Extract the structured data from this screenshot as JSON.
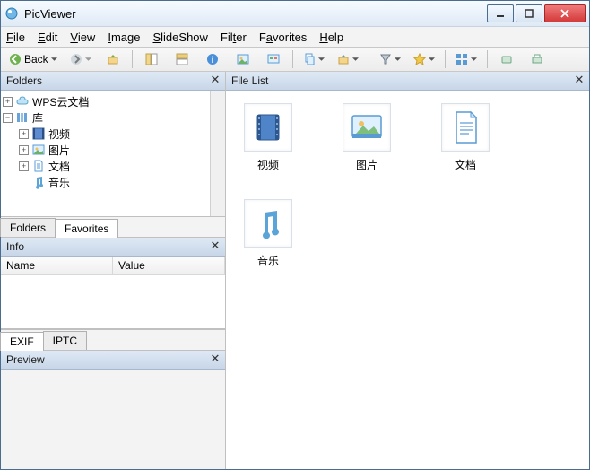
{
  "app": {
    "title": "PicViewer"
  },
  "menu": [
    "File",
    "Edit",
    "View",
    "Image",
    "SlideShow",
    "Filter",
    "Favorites",
    "Help"
  ],
  "toolbar": {
    "back": "Back"
  },
  "left": {
    "folders_panel_title": "Folders",
    "tree": {
      "root1": "WPS云文档",
      "root2": "库",
      "child_video": "视频",
      "child_images": "图片",
      "child_docs": "文档",
      "child_music": "音乐"
    },
    "folder_tabs": {
      "folders": "Folders",
      "favorites": "Favorites"
    },
    "info_panel_title": "Info",
    "info_cols": {
      "name": "Name",
      "value": "Value"
    },
    "info_tabs": {
      "exif": "EXIF",
      "iptc": "IPTC"
    },
    "preview_panel_title": "Preview"
  },
  "right": {
    "panel_title": "File List",
    "items": [
      {
        "name": "视频"
      },
      {
        "name": "图片"
      },
      {
        "name": "文档"
      },
      {
        "name": "音乐"
      }
    ]
  }
}
